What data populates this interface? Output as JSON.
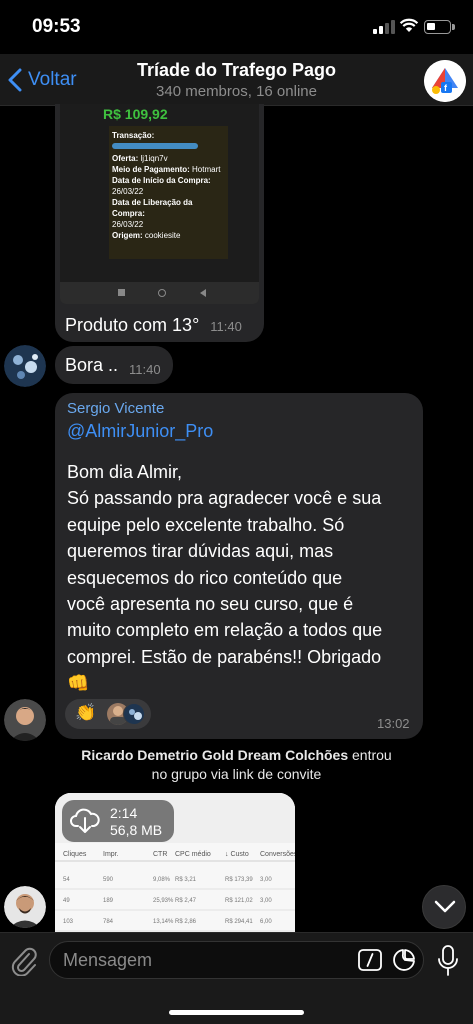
{
  "status": {
    "time": "09:53"
  },
  "header": {
    "back_label": "Voltar",
    "title": "Tríade do Trafego Pago",
    "subtitle": "340 membros, 16 online"
  },
  "image_message": {
    "price": "R$ 109,92",
    "receipt": {
      "transacao_label": "Transação:",
      "oferta_label": "Oferta:",
      "oferta_value": "lj1iqn7v",
      "pagamento_label": "Meio de Pagamento:",
      "pagamento_value": "Hotmart",
      "inicio_label": "Data de Início da Compra:",
      "inicio_value": "26/03/22",
      "liberacao_label": "Data de Liberação da Compra:",
      "liberacao_value": "26/03/22",
      "origem_label": "Origem:",
      "origem_value": "cookiesite"
    },
    "caption": "Produto com 13°",
    "time": "11:40"
  },
  "short_message": {
    "text": "Bora ..",
    "time": "11:40"
  },
  "long_message": {
    "sender": "Sergio Vicente",
    "mention": "@AlmirJunior_Pro",
    "lines": [
      "Bom dia Almir,",
      "Só passando pra agradecer você e sua",
      "equipe pelo excelente trabalho. Só",
      "queremos tirar dúvidas aqui, mas",
      "esquecemos do rico conteúdo que",
      "você apresenta no seu curso, que é",
      "muito completo em relação a todos que",
      "comprei. Estão de parabéns!! Obrigado",
      "👊"
    ],
    "reaction_emoji": "👏",
    "time": "13:02"
  },
  "system_message": {
    "name": "Ricardo Demetrio Gold Dream Colchões",
    "action_1": " entrou",
    "action_2": "no grupo via link de convite"
  },
  "video_message": {
    "duration": "2:14",
    "size": "56,8 MB",
    "table_headers": [
      "Cliques",
      "Impr.",
      "CTR",
      "CPC médio",
      "↓ Custo",
      "Conversões"
    ],
    "table_rows": [
      [
        "54",
        "590",
        "9,08%",
        "R$ 3,21",
        "R$ 173,39",
        "3,00"
      ],
      [
        "49",
        "189",
        "25,93%",
        "R$ 2,47",
        "R$ 121,02",
        "3,00"
      ],
      [
        "103",
        "784",
        "13,14%",
        "R$ 2,86",
        "R$ 294,41",
        "6,00"
      ]
    ]
  },
  "input": {
    "placeholder": "Mensagem"
  },
  "colors": {
    "accent": "#3e8ff5",
    "bubble": "#262628",
    "header": "#1a1a1a"
  }
}
